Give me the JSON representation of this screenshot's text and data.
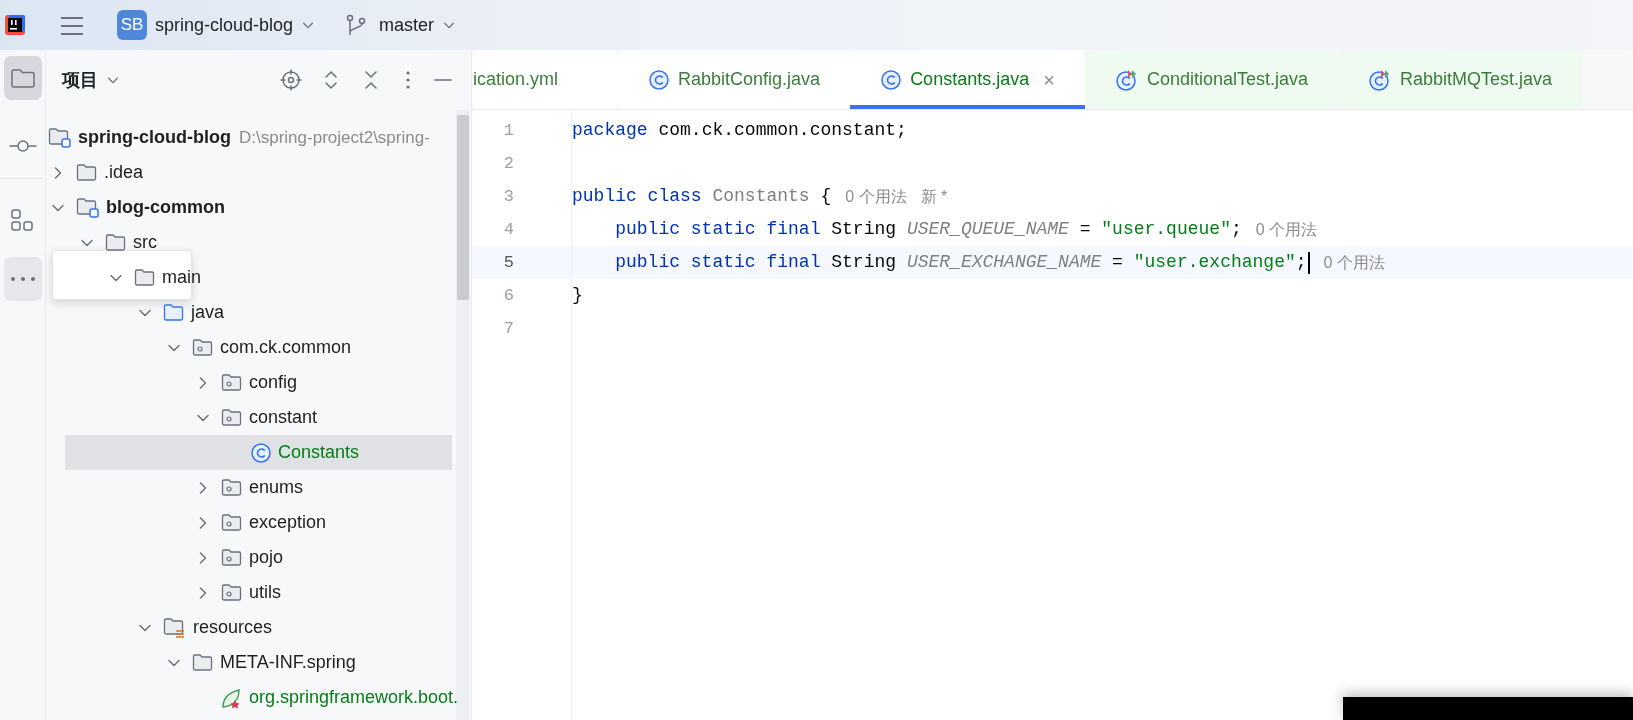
{
  "toolbar": {
    "project": {
      "badge": "SB",
      "name": "spring-cloud-blog"
    },
    "branch": "master"
  },
  "tool_strip": [
    {
      "kind": "project",
      "selected": true,
      "hovered": false
    },
    {
      "kind": "commit",
      "selected": false,
      "hovered": false
    },
    {
      "kind": "structure",
      "selected": false,
      "hovered": false
    },
    {
      "kind": "more",
      "selected": false,
      "hovered": true
    }
  ],
  "project_panel": {
    "title": "项目",
    "tree": [
      {
        "name": "spring-cloud-blog",
        "kind": "module",
        "path": "D:\\spring-project2\\spring-",
        "selected": false,
        "children": [
          {
            "name": ".idea",
            "kind": "folder",
            "expanded": false,
            "selected": false
          },
          {
            "name": "blog-common",
            "kind": "module",
            "expanded": true,
            "selected": false,
            "children": [
              {
                "name": "src",
                "kind": "folder",
                "expanded": true,
                "selected": false,
                "children": [
                  {
                    "name": "main",
                    "kind": "folder",
                    "expanded": true,
                    "selected": false,
                    "floating": true,
                    "children": [
                      {
                        "name": "java",
                        "kind": "source",
                        "expanded": true,
                        "selected": false,
                        "children": [
                          {
                            "name": "com.ck.common",
                            "kind": "package",
                            "expanded": true,
                            "selected": false,
                            "children": [
                              {
                                "name": "config",
                                "kind": "package",
                                "expanded": false,
                                "selected": false
                              },
                              {
                                "name": "constant",
                                "kind": "package",
                                "expanded": true,
                                "selected": false,
                                "children": [
                                  {
                                    "name": "Constants",
                                    "kind": "class",
                                    "selected": true,
                                    "color": "#067d17"
                                  }
                                ]
                              },
                              {
                                "name": "enums",
                                "kind": "package",
                                "expanded": false,
                                "selected": false
                              },
                              {
                                "name": "exception",
                                "kind": "package",
                                "expanded": false,
                                "selected": false
                              },
                              {
                                "name": "pojo",
                                "kind": "package",
                                "expanded": false,
                                "selected": false
                              },
                              {
                                "name": "utils",
                                "kind": "package",
                                "expanded": false,
                                "selected": false
                              }
                            ]
                          }
                        ]
                      },
                      {
                        "name": "resources",
                        "kind": "resources",
                        "expanded": true,
                        "selected": false,
                        "children": [
                          {
                            "name": "META-INF.spring",
                            "kind": "folder",
                            "expanded": true,
                            "selected": false,
                            "children": [
                              {
                                "name": "org.springframework.boot.",
                                "kind": "spring",
                                "selected": false,
                                "color": "#067d17"
                              }
                            ]
                          }
                        ]
                      }
                    ]
                  }
                ]
              }
            ]
          }
        ]
      }
    ]
  },
  "editor": {
    "tabs": [
      {
        "label": "ication.yml",
        "kind": "yml",
        "selected": false
      },
      {
        "label": "RabbitConfig.java",
        "kind": "class",
        "selected": false
      },
      {
        "label": "Constants.java",
        "kind": "class",
        "selected": true,
        "close": "×"
      },
      {
        "label": "ConditionalTest.java",
        "kind": "test",
        "selected": false
      },
      {
        "label": "RabbitMQTest.java",
        "kind": "test",
        "selected": false
      }
    ],
    "lines": [
      {
        "number": "1",
        "current": false,
        "tokens": [
          {
            "kind": "keyword",
            "text": "package"
          },
          {
            "kind": "plain",
            "text": " com.ck.common.constant;"
          }
        ]
      },
      {
        "number": "2",
        "current": false
      },
      {
        "number": "3",
        "current": false,
        "tokens": [
          {
            "kind": "keyword",
            "text": "public class"
          },
          {
            "kind": "unused",
            "text": " Constants"
          },
          {
            "kind": "plain",
            "text": " {"
          }
        ],
        "hints": [
          "0 个用法",
          "新 *"
        ]
      },
      {
        "number": "4",
        "current": false,
        "tokens": [
          {
            "kind": "keyword",
            "text": "    public static final"
          },
          {
            "kind": "plain",
            "text": " String "
          },
          {
            "kind": "field",
            "text": "USER_QUEUE_NAME"
          },
          {
            "kind": "plain",
            "text": " = "
          },
          {
            "kind": "string",
            "text": "\"user.queue\""
          },
          {
            "kind": "plain",
            "text": ";"
          }
        ],
        "hints": [
          "0 个用法"
        ]
      },
      {
        "number": "5",
        "current": true,
        "tokens": [
          {
            "kind": "keyword",
            "text": "    public static final"
          },
          {
            "kind": "plain",
            "text": " String "
          },
          {
            "kind": "field",
            "text": "USER_EXCHANGE_NAME"
          },
          {
            "kind": "plain",
            "text": " = "
          },
          {
            "kind": "string",
            "text": "\"user.exchange\""
          },
          {
            "kind": "plain",
            "text": ";"
          }
        ],
        "hints": [
          "0 个用法"
        ]
      },
      {
        "number": "6",
        "current": false,
        "tokens": [
          {
            "kind": "plain",
            "text": "}"
          }
        ]
      },
      {
        "number": "7",
        "current": false
      }
    ]
  }
}
